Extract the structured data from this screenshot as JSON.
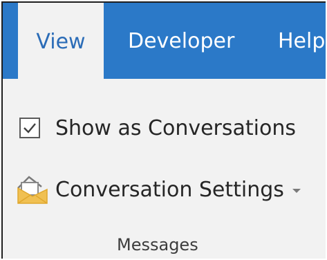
{
  "tabs": {
    "active": "View",
    "items": [
      "Developer",
      "Help"
    ]
  },
  "ribbon": {
    "checkbox": {
      "label": "Show as Conversations",
      "checked": true
    },
    "dropdown": {
      "label": "Conversation Settings",
      "icon": "envelope-open-icon",
      "chevron": "chevron-down-icon"
    },
    "group_label": "Messages"
  },
  "colors": {
    "tab_bar": "#2b79c8",
    "active_tab_text": "#2b6cb7",
    "ribbon_bg": "#f2f2f2"
  }
}
